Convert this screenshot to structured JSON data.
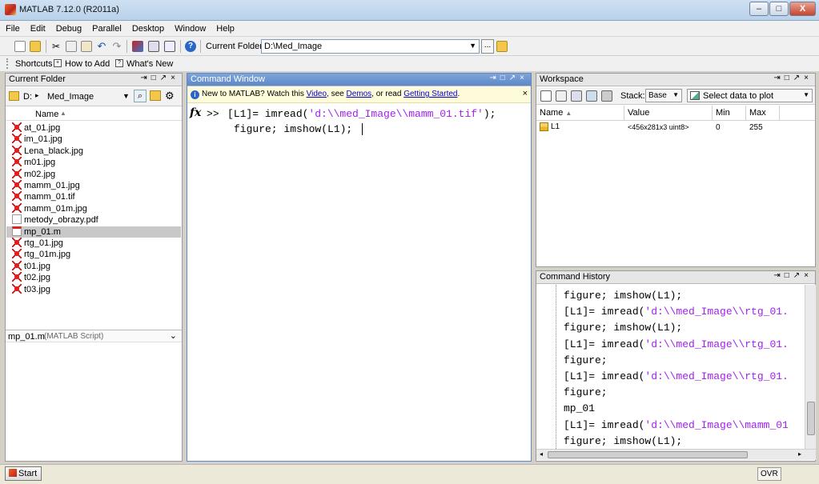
{
  "window": {
    "title": "MATLAB  7.12.0 (R2011a)",
    "min_label": "–",
    "max_label": "□",
    "close_label": "X"
  },
  "menu": [
    "File",
    "Edit",
    "Debug",
    "Parallel",
    "Desktop",
    "Window",
    "Help"
  ],
  "toolbar": {
    "current_folder_label": "Current Folder:",
    "current_folder_value": "D:\\Med_Image",
    "browse_label": "..."
  },
  "shortcuts": {
    "shortcuts_label": "Shortcuts",
    "how_to_add": "How to Add",
    "whats_new": "What's New"
  },
  "current_folder": {
    "title": "Current Folder",
    "drive": "D:",
    "folder": "Med_Image",
    "column_name": "Name",
    "files": [
      {
        "name": "at_01.jpg",
        "type": "img",
        "selected": false
      },
      {
        "name": "im_01.jpg",
        "type": "img",
        "selected": false
      },
      {
        "name": "Lena_black.jpg",
        "type": "img",
        "selected": false
      },
      {
        "name": "m01.jpg",
        "type": "img",
        "selected": false
      },
      {
        "name": "m02.jpg",
        "type": "img",
        "selected": false
      },
      {
        "name": "mamm_01.jpg",
        "type": "img",
        "selected": false
      },
      {
        "name": "mamm_01.tif",
        "type": "img",
        "selected": false
      },
      {
        "name": "mamm_01m.jpg",
        "type": "img",
        "selected": false
      },
      {
        "name": "metody_obrazy.pdf",
        "type": "pdf",
        "selected": false
      },
      {
        "name": "mp_01.m",
        "type": "m",
        "selected": true
      },
      {
        "name": "rtg_01.jpg",
        "type": "img",
        "selected": false
      },
      {
        "name": "rtg_01m.jpg",
        "type": "img",
        "selected": false
      },
      {
        "name": "t01.jpg",
        "type": "img",
        "selected": false
      },
      {
        "name": "t02.jpg",
        "type": "img",
        "selected": false
      },
      {
        "name": "t03.jpg",
        "type": "img",
        "selected": false
      }
    ],
    "details_name": "mp_01.m",
    "details_type": "(MATLAB Script)"
  },
  "command_window": {
    "title": "Command Window",
    "banner_prefix": "New to MATLAB? Watch this ",
    "banner_video": "Video",
    "banner_mid1": ", see ",
    "banner_demos": "Demos",
    "banner_mid2": ", or read ",
    "banner_getting_started": "Getting Started",
    "banner_suffix": ".",
    "fx_label": "fx",
    "prompt": ">>",
    "line1_code": "[L1]= imread(",
    "line1_string": "'d:\\\\med_Image\\\\mamm_01.tif'",
    "line1_end": ");",
    "line2": "figure; imshow(L1);"
  },
  "workspace": {
    "title": "Workspace",
    "stack_label": "Stack:",
    "stack_value": "Base",
    "plot_label": "Select data to plot",
    "columns": [
      "Name",
      "Value",
      "Min",
      "Max"
    ],
    "rows": [
      {
        "name": "L1",
        "value": "<456x281x3 uint8>",
        "min": "0",
        "max": "255"
      }
    ]
  },
  "command_history": {
    "title": "Command History",
    "lines": [
      {
        "code": "figure; imshow(L1);",
        "str": "",
        "end": ""
      },
      {
        "code": "[L1]= imread(",
        "str": "'d:\\\\med_Image\\\\rtg_01.",
        "end": ""
      },
      {
        "code": "figure; imshow(L1);",
        "str": "",
        "end": ""
      },
      {
        "code": "[L1]= imread(",
        "str": "'d:\\\\med_Image\\\\rtg_01.",
        "end": ""
      },
      {
        "code": "figure;",
        "str": "",
        "end": ""
      },
      {
        "code": "[L1]= imread(",
        "str": "'d:\\\\med_Image\\\\rtg_01.",
        "end": ""
      },
      {
        "code": "figure;",
        "str": "",
        "end": ""
      },
      {
        "code": "mp_01",
        "str": "",
        "end": ""
      },
      {
        "code": "[L1]= imread(",
        "str": "'d:\\\\med_Image\\\\mamm_01",
        "end": ""
      },
      {
        "code": "figure; imshow(L1);",
        "str": "",
        "end": ""
      }
    ]
  },
  "status": {
    "start_label": "Start",
    "ovr_label": "OVR"
  },
  "colors": {
    "string_purple": "#a020f0",
    "link_blue": "#0000cc",
    "active_header": "#5d89c9",
    "selected_row": "#c8c8c8"
  }
}
